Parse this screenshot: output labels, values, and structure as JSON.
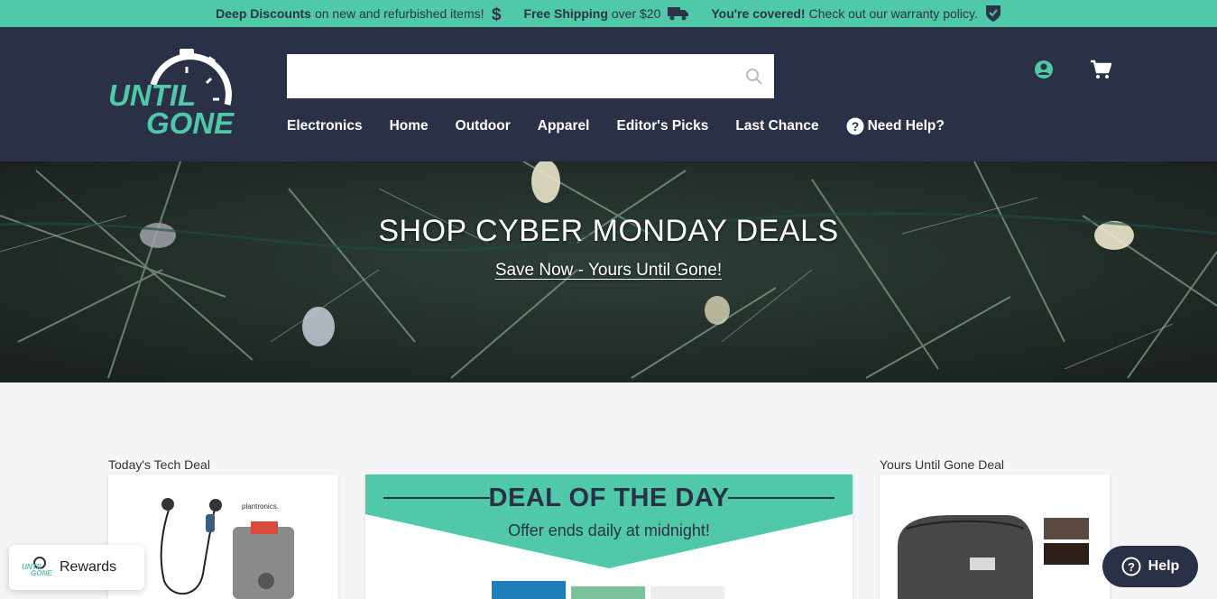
{
  "promo": [
    {
      "bold": "Deep Discounts",
      "text": "on new and refurbished items!",
      "icon": "dollar-icon"
    },
    {
      "bold": "Free Shipping",
      "text": "over $20",
      "icon": "truck-icon"
    },
    {
      "bold": "You're covered!",
      "text": "Check out our warranty policy.",
      "icon": "shield-check-icon"
    }
  ],
  "logo": {
    "line1": "UNTIL",
    "line2": "GONE"
  },
  "search": {
    "placeholder": "",
    "value": ""
  },
  "nav": [
    "Electronics",
    "Home",
    "Outdoor",
    "Apparel",
    "Editor's Picks",
    "Last Chance",
    "Need Help?"
  ],
  "hero": {
    "title": "SHOP CYBER MONDAY DEALS",
    "link": "Save Now - Yours Until Gone!"
  },
  "deals": {
    "tech_label": "Today's Tech Deal",
    "dotd_title": "DEAL OF THE DAY",
    "dotd_sub": "Offer ends daily at midnight!",
    "yug_label": "Yours Until Gone Deal",
    "tech_brand": "plantronics."
  },
  "rewards": "Rewards",
  "help": "Help",
  "colors": {
    "accent": "#4fc9a8",
    "navy": "#2a3146",
    "bg": "#f5f5f7"
  }
}
